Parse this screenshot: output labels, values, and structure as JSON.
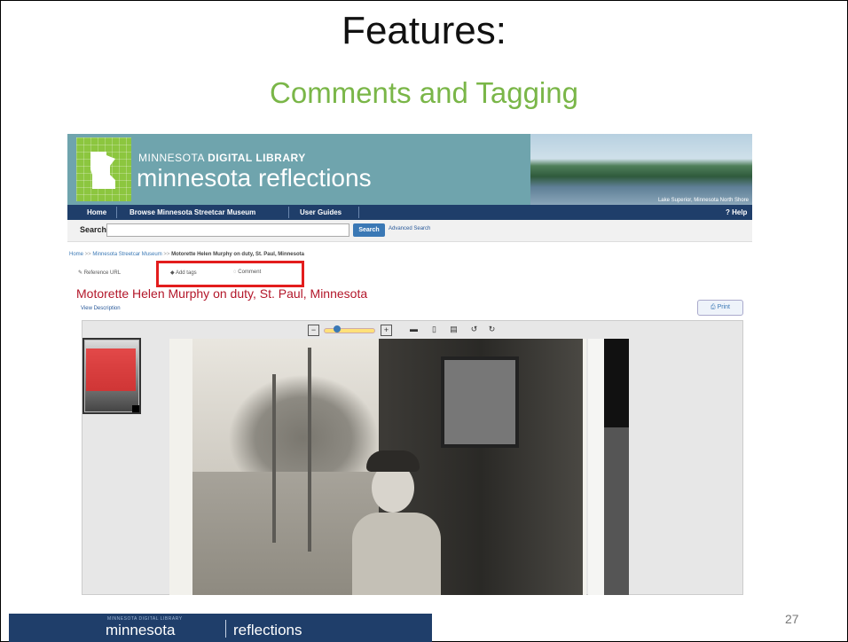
{
  "slide": {
    "title": "Features:",
    "subtitle": "Comments and Tagging",
    "page_number": "27",
    "colors": {
      "subtitle": "#7ab648",
      "title": "#111111"
    }
  },
  "site": {
    "brand_small_prefix": "MINNESOTA ",
    "brand_small_bold": "DIGITAL LIBRARY",
    "brand_name": "minnesota reflections",
    "banner_caption": "Lake Superior, Minnesota North Shore",
    "nav": {
      "items": [
        "Home",
        "Browse Minnesota Streetcar Museum",
        "User Guides"
      ],
      "help": "? Help"
    },
    "search": {
      "label": "Search",
      "value": "",
      "button": "Search",
      "advanced": "Advanced Search"
    },
    "breadcrumb": {
      "home": "Home",
      "sep": " >> ",
      "collection": "Minnesota Streetcar Museum",
      "current": "Motorette Helen Murphy on duty, St. Paul, Minnesota"
    },
    "actions": {
      "reference": "Reference URL",
      "add_tags": "Add tags",
      "comment": "Comment"
    },
    "item": {
      "title": "Motorette Helen Murphy on duty, St. Paul, Minnesota",
      "view_description": "View Description",
      "print": "Print"
    },
    "viewer": {
      "zoom_level": 0.15,
      "tools": [
        "zoom-out-icon",
        "zoom-in-icon",
        "fit-width-icon",
        "fit-page-icon",
        "page-icon",
        "rotate-left-icon",
        "rotate-right-icon"
      ]
    },
    "colors": {
      "nav_bg": "#1f3e6a",
      "banner_bg": "#6fa4ad",
      "title_red": "#b3172a",
      "highlight": "#e31d1d"
    }
  },
  "footer": {
    "small": "MINNESOTA DIGITAL LIBRARY",
    "left": "minnesota",
    "right": "reflections"
  }
}
